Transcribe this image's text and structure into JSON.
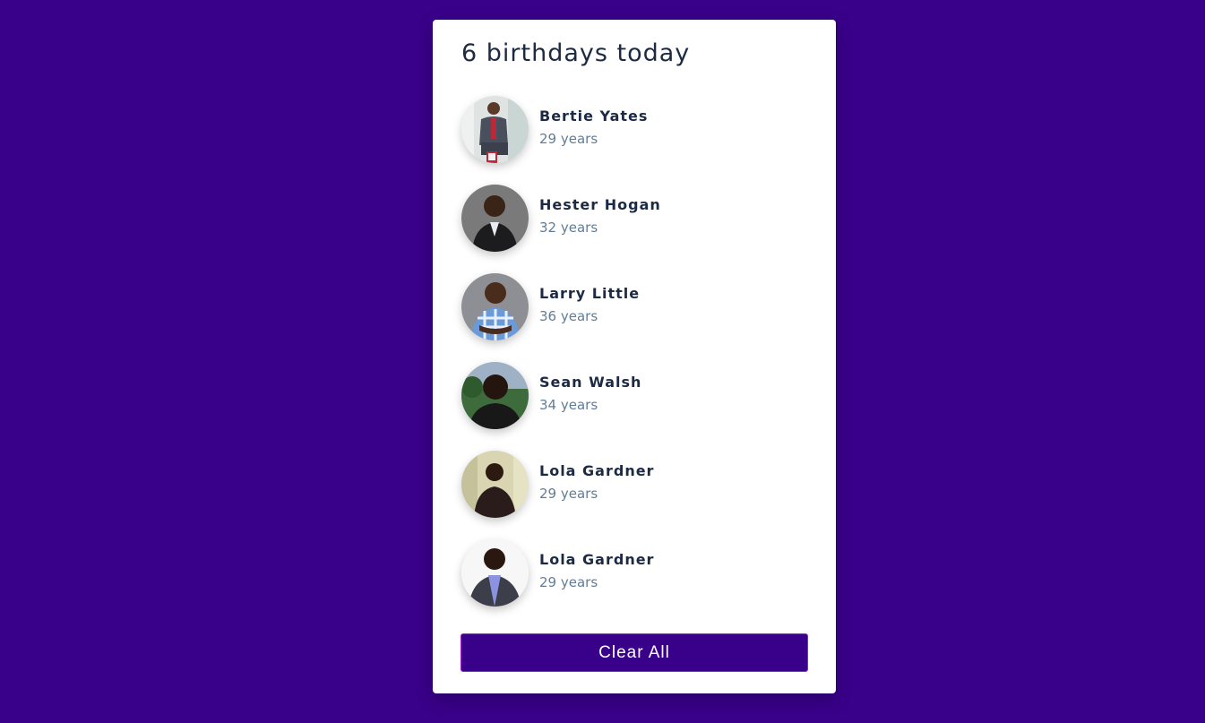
{
  "title": "6 birthdays today",
  "people": [
    {
      "name": "Bertie Yates",
      "age": "29 years"
    },
    {
      "name": "Hester Hogan",
      "age": "32 years"
    },
    {
      "name": "Larry Little",
      "age": "36 years"
    },
    {
      "name": "Sean Walsh",
      "age": "34 years"
    },
    {
      "name": "Lola Gardner",
      "age": "29 years"
    },
    {
      "name": "Lola Gardner",
      "age": "29 years"
    }
  ],
  "clear_button": "Clear All",
  "colors": {
    "background": "#390189",
    "card": "#ffffff",
    "name_text": "#1c2a44",
    "age_text": "#617d98",
    "button": "#390189"
  }
}
